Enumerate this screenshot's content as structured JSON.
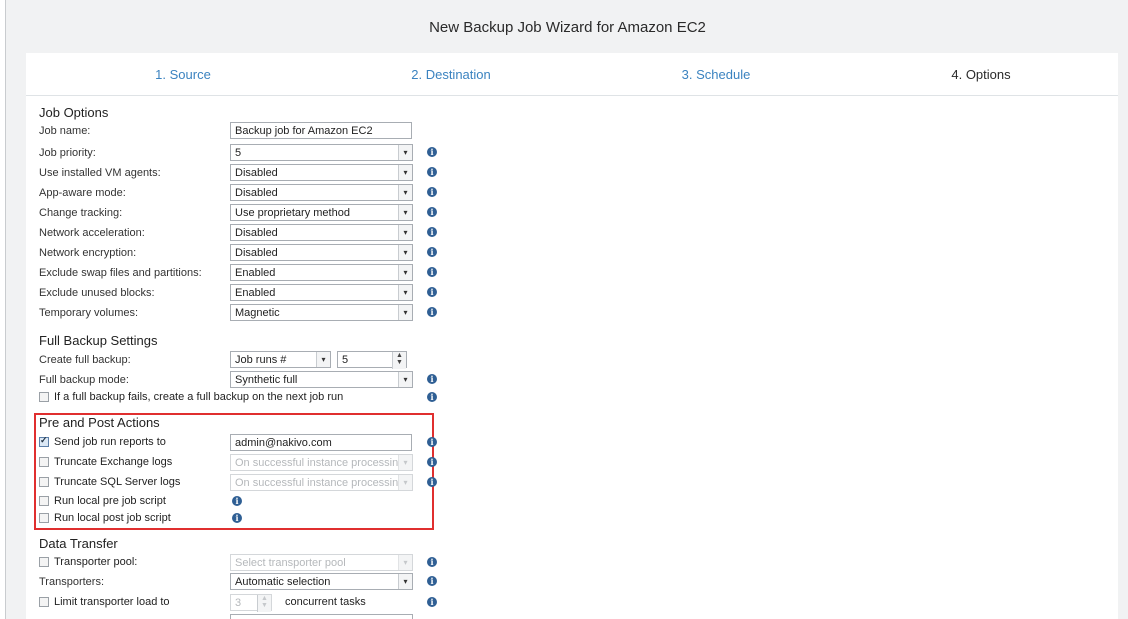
{
  "window": {
    "title": "New Backup Job Wizard for Amazon EC2"
  },
  "steps": [
    "1. Source",
    "2. Destination",
    "3. Schedule",
    "4. Options"
  ],
  "job_options": {
    "heading": "Job Options",
    "job_name_label": "Job name:",
    "job_name_value": "Backup job for Amazon EC2",
    "rows": [
      {
        "label": "Job priority:",
        "value": "5"
      },
      {
        "label": "Use installed VM agents:",
        "value": "Disabled"
      },
      {
        "label": "App-aware mode:",
        "value": "Disabled"
      },
      {
        "label": "Change tracking:",
        "value": "Use proprietary method"
      },
      {
        "label": "Network acceleration:",
        "value": "Disabled"
      },
      {
        "label": "Network encryption:",
        "value": "Disabled"
      },
      {
        "label": "Exclude swap files and partitions:",
        "value": "Enabled"
      },
      {
        "label": "Exclude unused blocks:",
        "value": "Enabled"
      },
      {
        "label": "Temporary volumes:",
        "value": "Magnetic"
      }
    ]
  },
  "full_backup": {
    "heading": "Full Backup Settings",
    "create_label": "Create full backup:",
    "create_mode": "Job runs #",
    "create_count": "5",
    "mode_label": "Full backup mode:",
    "mode_value": "Synthetic full",
    "fail_checkbox_label": "If a full backup fails, create a full backup on the next job run"
  },
  "pre_post": {
    "heading": "Pre and Post Actions",
    "send_reports_label": "Send job run reports to",
    "send_reports_value": "admin@nakivo.com",
    "truncate_exchange_label": "Truncate Exchange logs",
    "truncate_exchange_value": "On successful instance processing",
    "truncate_sql_label": "Truncate SQL Server logs",
    "truncate_sql_value": "On successful instance processing",
    "pre_script_label": "Run local pre job script",
    "post_script_label": "Run local post job script"
  },
  "data_transfer": {
    "heading": "Data Transfer",
    "pool_label": "Transporter pool:",
    "pool_placeholder": "Select transporter pool",
    "transporters_label": "Transporters:",
    "transporters_value": "Automatic selection",
    "limit_label": "Limit transporter load to",
    "limit_value": "3",
    "limit_unit": "concurrent tasks"
  },
  "colors": {
    "link": "#3b83c0",
    "highlight": "#e02f2f",
    "info": "#2f5f94"
  },
  "icons": {
    "info": "info-icon",
    "dropdown": "chevron-down-icon",
    "checkbox": "checkbox"
  }
}
